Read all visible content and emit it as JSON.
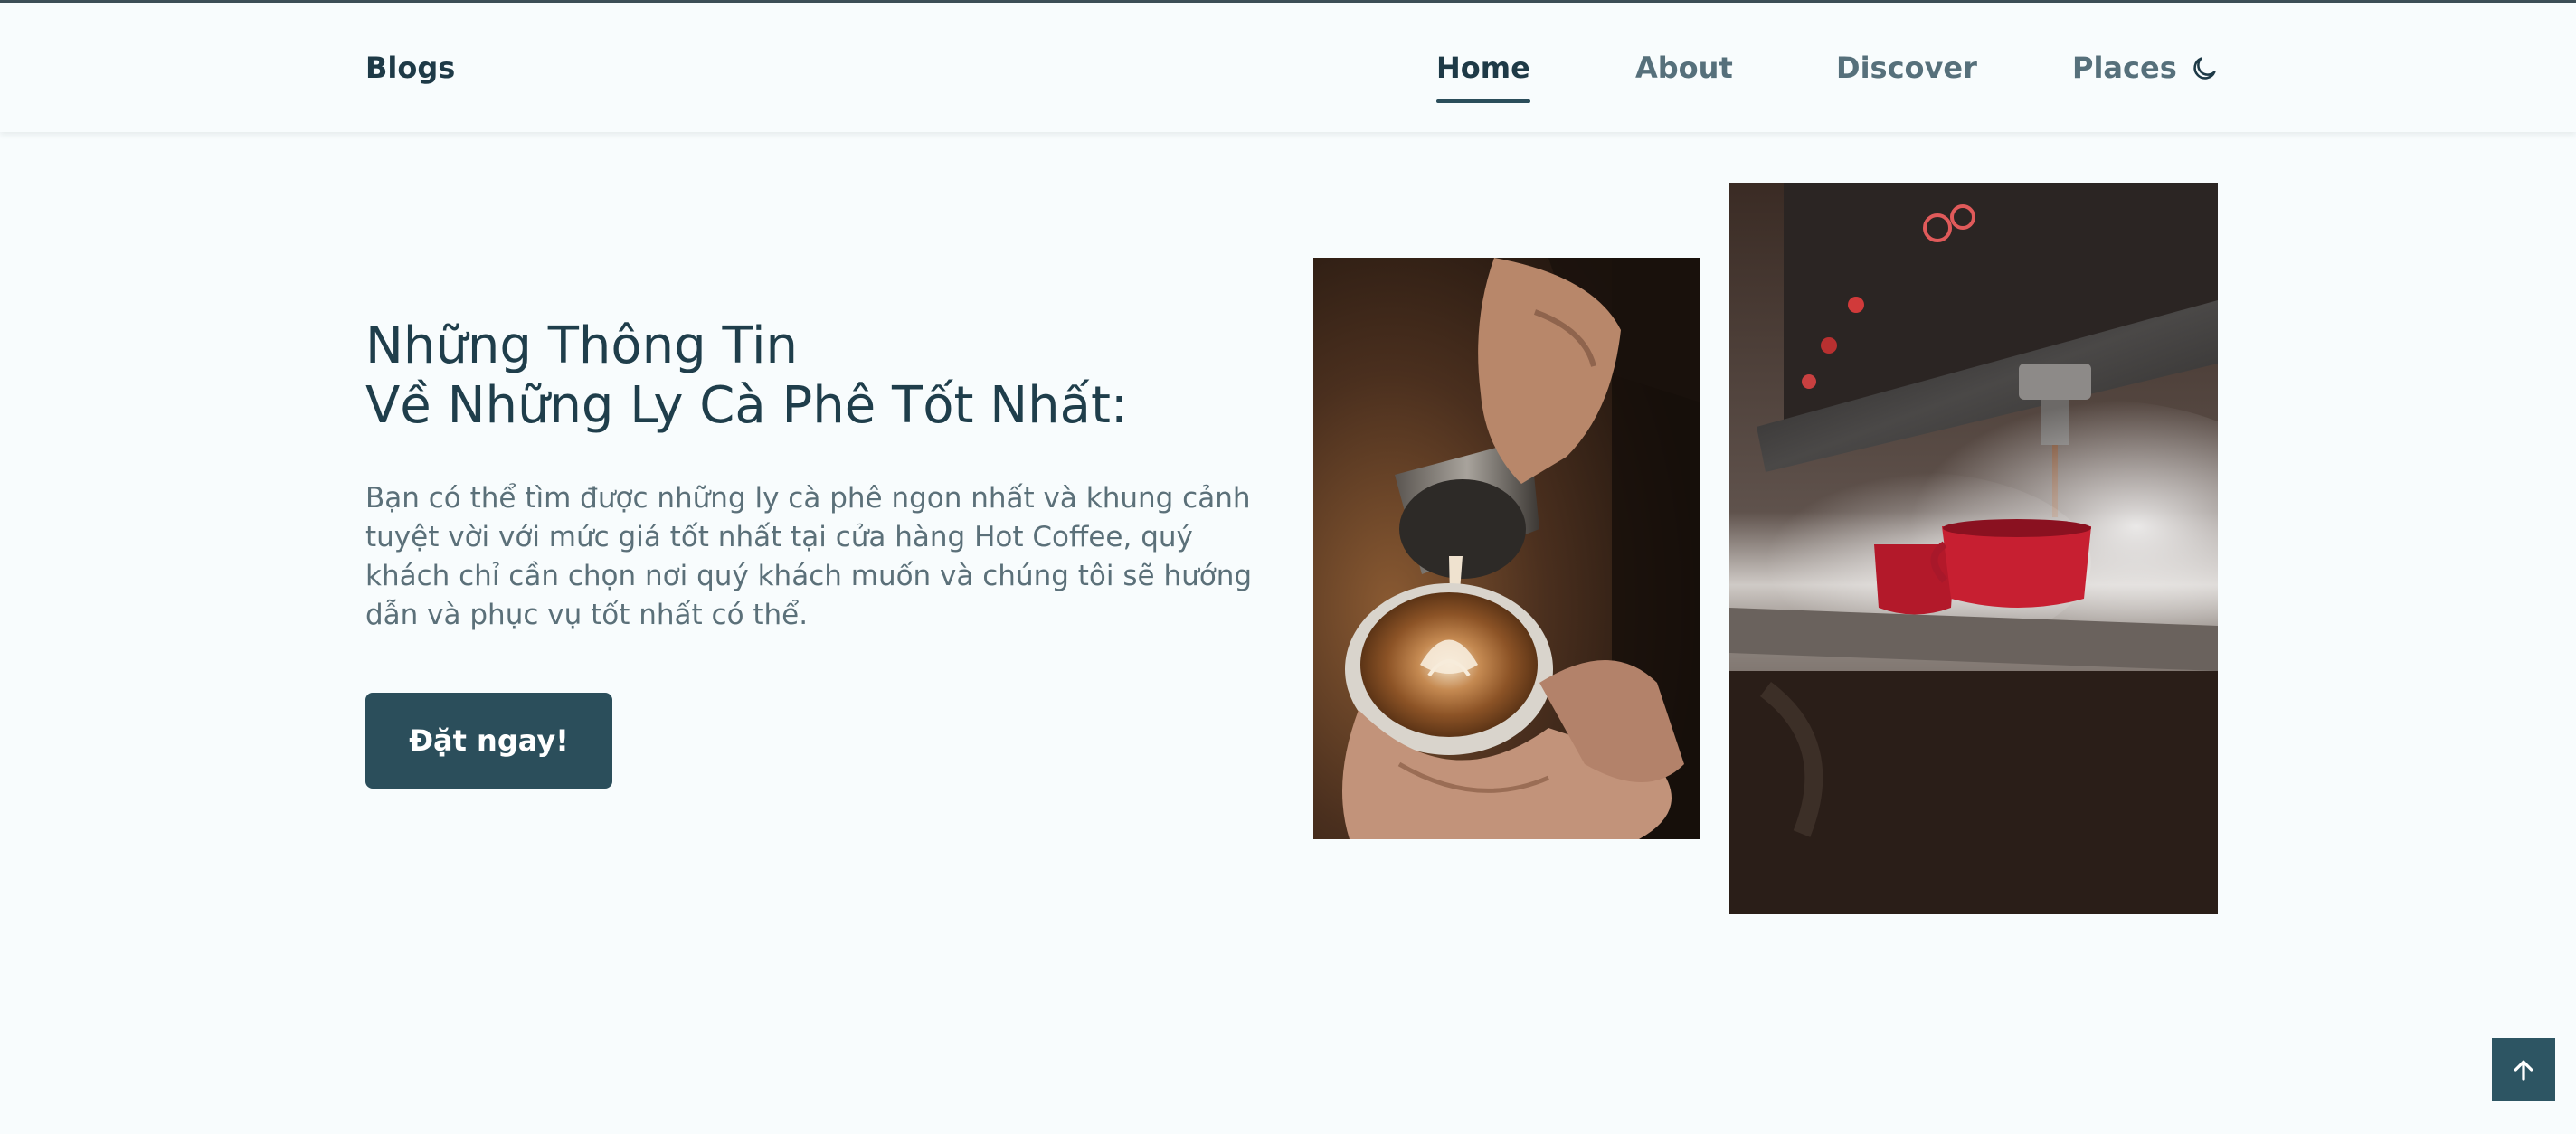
{
  "header": {
    "logo": "Blogs",
    "nav": [
      {
        "label": "Home",
        "active": true
      },
      {
        "label": "About",
        "active": false
      },
      {
        "label": "Discover",
        "active": false
      },
      {
        "label": "Places",
        "active": false
      }
    ],
    "theme_toggle_icon": "moon-icon"
  },
  "hero": {
    "title_line1": "Những Thông Tin",
    "title_line2": "Về Những Ly Cà Phê Tốt Nhất:",
    "description": "Bạn có thể tìm được những ly cà phê ngon nhất và khung cảnh tuyệt vời với mức giá tốt nhất tại cửa hàng Hot Coffee, quý khách chỉ cần chọn nơi quý khách muốn và chúng tôi sẽ hướng dẫn và phục vụ tốt nhất có thể.",
    "cta_label": "Đặt ngay!",
    "images": [
      {
        "icon": "latte-art-photo"
      },
      {
        "icon": "espresso-machine-photo"
      }
    ]
  },
  "scroll_top_icon": "arrow-up-icon",
  "colors": {
    "background": "#f8fcfd",
    "primary": "#2b4e5b",
    "heading": "#1f3e4b",
    "text": "#5b7079"
  }
}
